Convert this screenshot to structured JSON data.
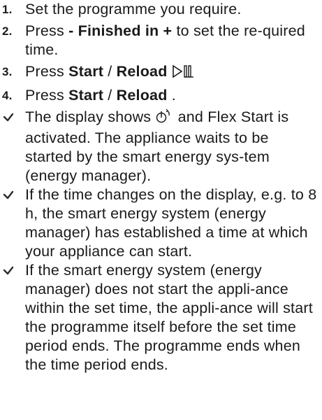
{
  "steps": [
    {
      "num": "1.",
      "text": "Set the programme you require."
    },
    {
      "num": "2.",
      "bold": "- Finished in +",
      "pre": "Press ",
      "post": "  to set the re-quired time."
    },
    {
      "num": "3.",
      "pre": "Press ",
      "bold1": "Start",
      "mid": " / ",
      "bold2": "Reload",
      "icon": "start-pause-icon"
    },
    {
      "num": "4.",
      "pre": "Press ",
      "bold1": "Start",
      "mid": " / ",
      "bold2": "Reload",
      "post": " ."
    }
  ],
  "results": [
    {
      "pre": "The display shows ",
      "icon": "flex-start-icon",
      "post": " and Flex Start is activated. The appliance waits to be started by the smart energy sys-tem (energy manager)."
    },
    {
      "text": "If the time changes on the display, e.g. to 8 h, the smart energy system (energy manager) has established a time at which your appliance can start."
    },
    {
      "text": "If the smart energy system (energy manager) does not start the appli-ance within the set time, the appli-ance will start the programme itself before the set time period ends. The programme ends when the time period ends."
    }
  ],
  "colors": {
    "text": "#1a1a1a",
    "check": "#2b2b2b"
  }
}
